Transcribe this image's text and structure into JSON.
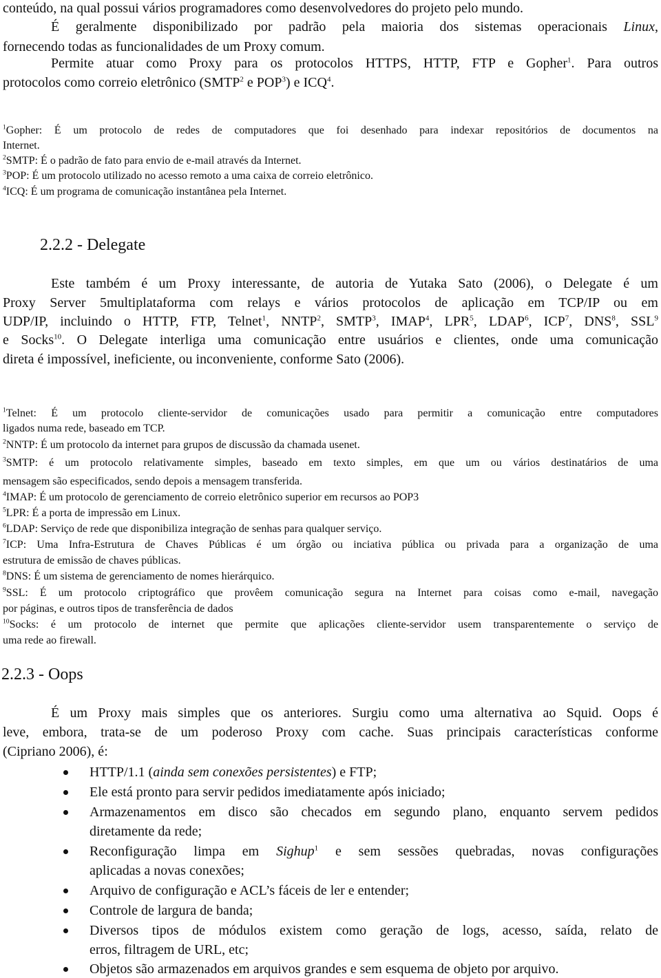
{
  "intro": {
    "line1": "conteúdo, na qual possui vários programadores como desenvolvedores do projeto pelo mundo.",
    "p2_start": "É geralmente disponibilizado por padrão pela maioria dos sistemas operacionais ",
    "p2_italic": "Linux",
    "p2_end": ",",
    "p2_line2": "fornecendo todas as funcionalidades de um Proxy comum.",
    "p3_line1_a": "Permite atuar como Proxy para os protocolos HTTPS, HTTP, FTP e Gopher",
    "p3_line1_sup": "1",
    "p3_line1_b": ". Para outros",
    "p3_line2_a": "protocolos como correio eletrônico (SMTP",
    "p3_line2_sup1": "2",
    "p3_line2_b": " e POP",
    "p3_line2_sup2": "3",
    "p3_line2_c": ") e ICQ",
    "p3_line2_sup3": "4",
    "p3_line2_d": "."
  },
  "footnotes1": [
    {
      "num": "1",
      "line1": "Gopher: É um protocolo de redes de computadores que foi desenhado para indexar repositórios de documentos na",
      "line2": "Internet."
    },
    {
      "num": "2",
      "line1": "SMTP: É o padrão de fato para envio de e-mail através da Internet."
    },
    {
      "num": "3",
      "line1": "POP: É um protocolo utilizado no acesso remoto a uma caixa de correio eletrônico."
    },
    {
      "num": "4",
      "line1": "ICQ: É um programa de comunicação instantânea pela Internet."
    }
  ],
  "section_delegate": {
    "heading": "2.2.2 - Delegate",
    "line1": "Este também é um Proxy interessante, de autoria de Yutaka Sato (2006), o Delegate é um",
    "line2": "Proxy Server 5multiplataforma com relays e vários protocolos de aplicação em TCP/IP ou em",
    "line3_parts": [
      {
        "text": "UDP/IP, incluindo o HTTP, FTP, Telnet",
        "sup": "1"
      },
      {
        "text": ", NNTP",
        "sup": "2"
      },
      {
        "text": ", SMTP",
        "sup": "3"
      },
      {
        "text": ", IMAP",
        "sup": "4"
      },
      {
        "text": ", LPR",
        "sup": "5"
      },
      {
        "text": ", LDAP",
        "sup": "6"
      },
      {
        "text": ", ICP",
        "sup": "7"
      },
      {
        "text": ", DNS",
        "sup": "8"
      },
      {
        "text": ", SSL",
        "sup": "9"
      }
    ],
    "line4_a": "e Socks",
    "line4_sup": "10",
    "line4_b": ". O Delegate interliga uma comunicação entre usuários e clientes, onde uma comunicação",
    "line5": "direta é impossível, ineficiente, ou inconveniente, conforme Sato (2006)."
  },
  "footnotes2": [
    {
      "num": "1",
      "line1": "Telnet: É um protocolo cliente-servidor de comunicações usado para permitir a comunicação entre computadores",
      "line2": "ligados numa rede, baseado em TCP."
    },
    {
      "num": "2",
      "line1": "NNTP: É um protocolo da internet para grupos de discussão da chamada usenet."
    },
    {
      "num": "3",
      "line1": "SMTP: é um protocolo relativamente simples, baseado em texto simples, em que um ou vários destinatários de uma",
      "line2": "mensagem são especificados, sendo depois a mensagem transferida."
    },
    {
      "num": "4",
      "line1": "IMAP: É um protocolo de gerenciamento de correio eletrônico superior em recursos ao POP3"
    },
    {
      "num": "5",
      "line1": "LPR: É a porta de impressão em Linux."
    },
    {
      "num": "6",
      "line1": "LDAP: Serviço de rede que disponibiliza integração de senhas para qualquer serviço."
    },
    {
      "num": "7",
      "line1": "ICP: Uma Infra-Estrutura de Chaves Públicas é um órgão ou inciativa pública ou privada para a organização de uma",
      "line2": "estrutura de emissão de chaves públicas."
    },
    {
      "num": "8",
      "line1": "DNS: É um sistema de gerenciamento de nomes hierárquico."
    },
    {
      "num": "9",
      "line1": "SSL: É um protocolo criptográfico que provêem comunicação segura na Internet para coisas como e-mail, navegação",
      "line2": "por páginas, e outros tipos de transferência de dados"
    },
    {
      "num": "10",
      "line1": "Socks: é um protocolo de internet que permite que aplicações cliente-servidor usem transparentemente o serviço de",
      "line2": "uma rede ao firewall."
    }
  ],
  "section_oops": {
    "heading": "2.2.3 - Oops",
    "line1": "É um Proxy mais simples que os anteriores. Surgiu como uma alternativa ao Squid. Oops é",
    "line2": "leve, embora, trata-se de um poderoso Proxy com cache. Suas principais características conforme",
    "line3": "(Cipriano 2006), é:",
    "bullets": {
      "b1_a": "HTTP/1.1 (",
      "b1_italic": "ainda sem conexões persistentes",
      "b1_b": ") e FTP;",
      "b2": "Ele está pronto para servir pedidos imediatamente após iniciado;",
      "b3_line1": "Armazenamentos em disco são checados em segundo plano, enquanto servem pedidos",
      "b3_line2": "diretamente da rede;",
      "b4_a": "Reconfiguração limpa em ",
      "b4_italic": "Sighup",
      "b4_sup": "1",
      "b4_b": " e sem sessões quebradas, novas configurações",
      "b4_line2": "aplicadas a novas conexões;",
      "b5": "Arquivo de configuração e ACL’s fáceis de ler e entender;",
      "b6": "Controle de largura de banda;",
      "b7_line1": "Diversos tipos de módulos existem como geração de logs, acesso, saída, relato de",
      "b7_line2": "erros, filtragem de URL, etc;",
      "b8": "Objetos são armazenados em arquivos grandes e sem esquema de objeto por arquivo."
    }
  }
}
